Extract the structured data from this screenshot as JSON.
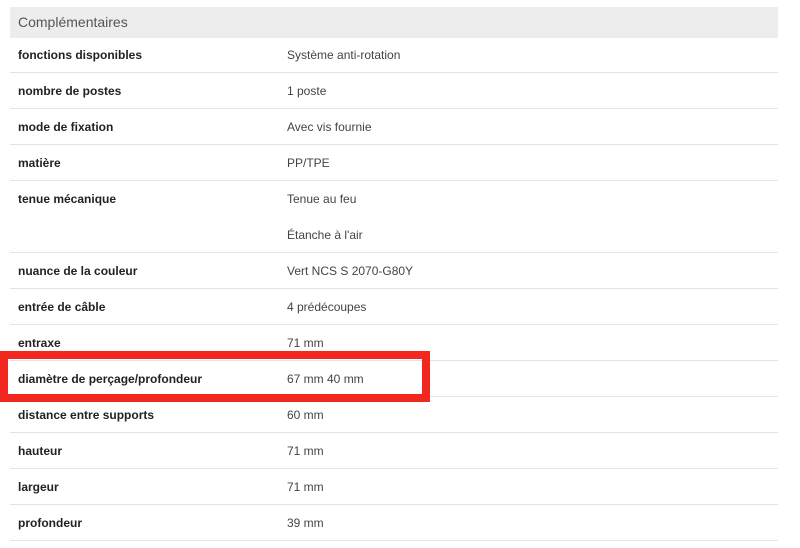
{
  "section": {
    "title": "Complémentaires"
  },
  "rows": [
    {
      "label": "fonctions disponibles",
      "value": "Système anti-rotation"
    },
    {
      "label": "nombre de postes",
      "value": "1 poste"
    },
    {
      "label": "mode de fixation",
      "value": "Avec vis fournie"
    },
    {
      "label": "matière",
      "value": "PP/TPE"
    },
    {
      "label": "tenue mécanique",
      "value": "Tenue au feu"
    },
    {
      "label": "",
      "value": "Étanche à l'air"
    },
    {
      "label": "nuance de la couleur",
      "value": "Vert NCS S 2070-G80Y"
    },
    {
      "label": "entrée de câble",
      "value": "4 prédécoupes"
    },
    {
      "label": "entraxe",
      "value": "71 mm"
    },
    {
      "label": "diamètre de perçage/profondeur",
      "value": "67 mm 40 mm"
    },
    {
      "label": "distance entre supports",
      "value": "60 mm"
    },
    {
      "label": "hauteur",
      "value": "71 mm"
    },
    {
      "label": "largeur",
      "value": "71 mm"
    },
    {
      "label": "profondeur",
      "value": "39 mm"
    }
  ],
  "highlight": {
    "color": "#f2281f"
  }
}
